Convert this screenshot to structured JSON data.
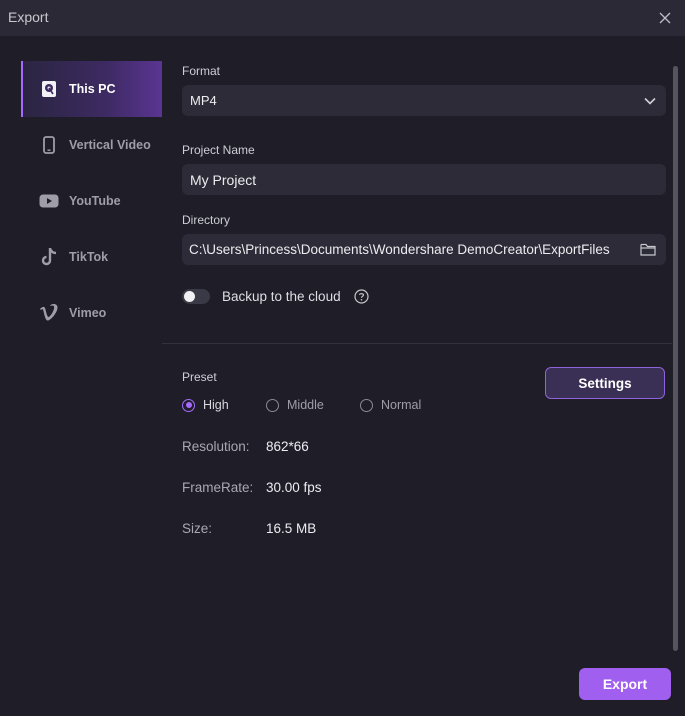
{
  "window": {
    "title": "Export"
  },
  "sidebar": {
    "items": [
      {
        "label": "This PC",
        "icon": "pc-icon",
        "active": true
      },
      {
        "label": "Vertical Video",
        "icon": "phone-icon"
      },
      {
        "label": "YouTube",
        "icon": "youtube-icon"
      },
      {
        "label": "TikTok",
        "icon": "tiktok-icon"
      },
      {
        "label": "Vimeo",
        "icon": "vimeo-icon"
      }
    ]
  },
  "format": {
    "label": "Format",
    "value": "MP4"
  },
  "project_name": {
    "label": "Project Name",
    "value": "My Project"
  },
  "directory": {
    "label": "Directory",
    "value": "C:\\Users\\Princess\\Documents\\Wondershare DemoCreator\\ExportFiles"
  },
  "backup": {
    "label": "Backup to the cloud",
    "enabled": false
  },
  "preset": {
    "label": "Preset",
    "options": [
      "High",
      "Middle",
      "Normal"
    ],
    "selected": "High"
  },
  "settings_button": {
    "label": "Settings"
  },
  "info": {
    "resolution": {
      "key": "Resolution:",
      "value": "862*66"
    },
    "framerate": {
      "key": "FrameRate:",
      "value": "30.00 fps"
    },
    "size": {
      "key": "Size:",
      "value": "16.5 MB"
    }
  },
  "export_button": {
    "label": "Export"
  },
  "colors": {
    "accent": "#a15ff0",
    "background": "#1e1d28",
    "field": "#2c2b37"
  }
}
